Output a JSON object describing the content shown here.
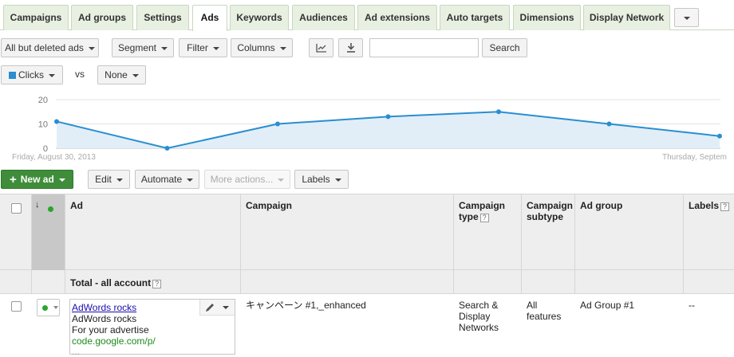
{
  "tabs": [
    {
      "label": "Campaigns"
    },
    {
      "label": "Ad groups"
    },
    {
      "label": "Settings"
    },
    {
      "label": "Ads"
    },
    {
      "label": "Keywords"
    },
    {
      "label": "Audiences"
    },
    {
      "label": "Ad extensions"
    },
    {
      "label": "Auto targets"
    },
    {
      "label": "Dimensions"
    },
    {
      "label": "Display Network"
    }
  ],
  "active_tab": "Ads",
  "toolbar": {
    "filter_status": "All but deleted ads",
    "segment": "Segment",
    "filter": "Filter",
    "columns": "Columns",
    "search_value": "",
    "search_button": "Search"
  },
  "chart_controls": {
    "metric1": "Clicks",
    "metric1_color": "#2a8ed0",
    "vs": "vs",
    "metric2": "None"
  },
  "chart_data": {
    "type": "area",
    "x": [
      "Friday, August 30, 2013",
      "",
      "",
      "",
      "",
      "",
      "Thursday, September"
    ],
    "series": [
      {
        "values": [
          11,
          0,
          10,
          13,
          15,
          10,
          5
        ],
        "color": "#2a8ed0"
      }
    ],
    "yticks": [
      0,
      10,
      20
    ],
    "ylim": [
      0,
      20
    ],
    "x_start_label": "Friday, August 30, 2013",
    "x_end_label": "Thursday, Septem",
    "grid": true
  },
  "actions": {
    "new_ad": "New ad",
    "edit": "Edit",
    "automate": "Automate",
    "more_actions": "More actions...",
    "labels": "Labels"
  },
  "table": {
    "headers": {
      "ad": "Ad",
      "campaign": "Campaign",
      "campaign_type_l1": "Campaign",
      "campaign_type_l2": "type",
      "campaign_subtype_l1": "Campaign",
      "campaign_subtype_l2": "subtype",
      "ad_group": "Ad group",
      "labels": "Labels"
    },
    "total_label": "Total - all account",
    "help_glyph": "?",
    "rows": [
      {
        "ad_title": "AdWords rocks",
        "ad_line1": "AdWords rocks",
        "ad_line2": "For your advertise",
        "ad_url": "code.google.com/p/",
        "ad_line3": "...",
        "campaign": "キャンペーン #1,_enhanced",
        "campaign_type_l1": "Search &",
        "campaign_type_l2": "Display",
        "campaign_type_l3": "Networks",
        "campaign_subtype_l1": "All",
        "campaign_subtype_l2": "features",
        "ad_group": "Ad Group #1",
        "labels": "--"
      }
    ]
  }
}
